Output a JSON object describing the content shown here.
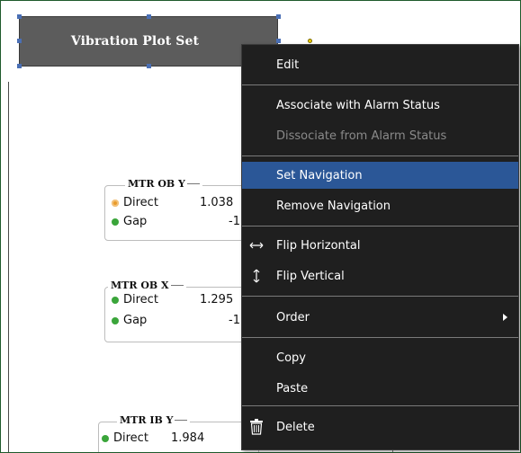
{
  "canvas": {
    "title_box_label": "Vibration Plot Set"
  },
  "panels": [
    {
      "title": "MTR OB Y",
      "rows": [
        {
          "label": "Direct",
          "value": "1.038",
          "status": "orange"
        },
        {
          "label": "Gap",
          "value": "-1",
          "status": "green"
        }
      ]
    },
    {
      "title": "MTR OB X",
      "rows": [
        {
          "label": "Direct",
          "value": "1.295",
          "status": "green"
        },
        {
          "label": "Gap",
          "value": "-1",
          "status": "green"
        }
      ]
    },
    {
      "title": "MTR IB Y",
      "rows": [
        {
          "label": "Direct",
          "value": "1.984",
          "status": "green"
        }
      ]
    }
  ],
  "context_menu": {
    "items": [
      {
        "label": "Edit",
        "disabled": false,
        "highlighted": false
      },
      {
        "label": "Associate with Alarm Status",
        "disabled": false,
        "highlighted": false
      },
      {
        "label": "Dissociate from Alarm Status",
        "disabled": true,
        "highlighted": false
      },
      {
        "label": "Set Navigation",
        "disabled": false,
        "highlighted": true
      },
      {
        "label": "Remove Navigation",
        "disabled": false,
        "highlighted": false
      },
      {
        "label": "Flip Horizontal",
        "disabled": false,
        "highlighted": false,
        "icon": "flip-horizontal-icon"
      },
      {
        "label": "Flip Vertical",
        "disabled": false,
        "highlighted": false,
        "icon": "flip-vertical-icon"
      },
      {
        "label": "Order",
        "disabled": false,
        "highlighted": false,
        "submenu": true
      },
      {
        "label": "Copy",
        "disabled": false,
        "highlighted": false
      },
      {
        "label": "Paste",
        "disabled": false,
        "highlighted": false
      },
      {
        "label": "Delete",
        "disabled": false,
        "highlighted": false,
        "icon": "trash-icon"
      }
    ]
  },
  "colors": {
    "menu_background": "#1f1f1f",
    "menu_highlight": "#2b5797",
    "title_box": "#5c5c5c",
    "status_green": "#3aa53a",
    "status_orange": "#e89b2b"
  }
}
